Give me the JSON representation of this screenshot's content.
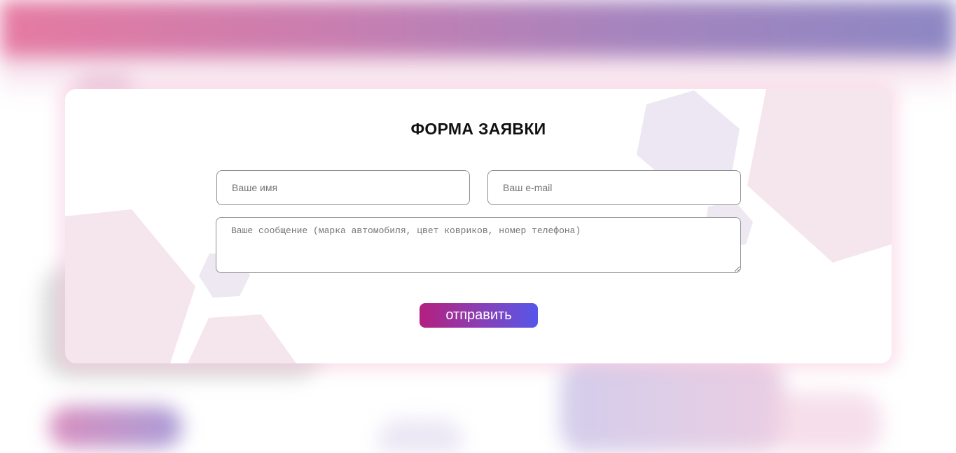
{
  "form": {
    "title": "ФОРМА ЗАЯВКИ",
    "name_placeholder": "Ваше имя",
    "email_placeholder": "Ваш e-mail",
    "message_placeholder": "Ваше сообщение (марка автомобиля, цвет ковриков, номер телефона)",
    "submit_label": "отправить"
  },
  "colors": {
    "header_gradient_start": "#e87aa0",
    "header_gradient_end": "#8a88c4",
    "button_gradient_start": "#b31f7f",
    "button_gradient_end": "#5556ea",
    "decor_pink": "#f3e0ea",
    "decor_lavender": "#ebe6f1"
  },
  "icons": [
    "hexagon-decoration"
  ]
}
